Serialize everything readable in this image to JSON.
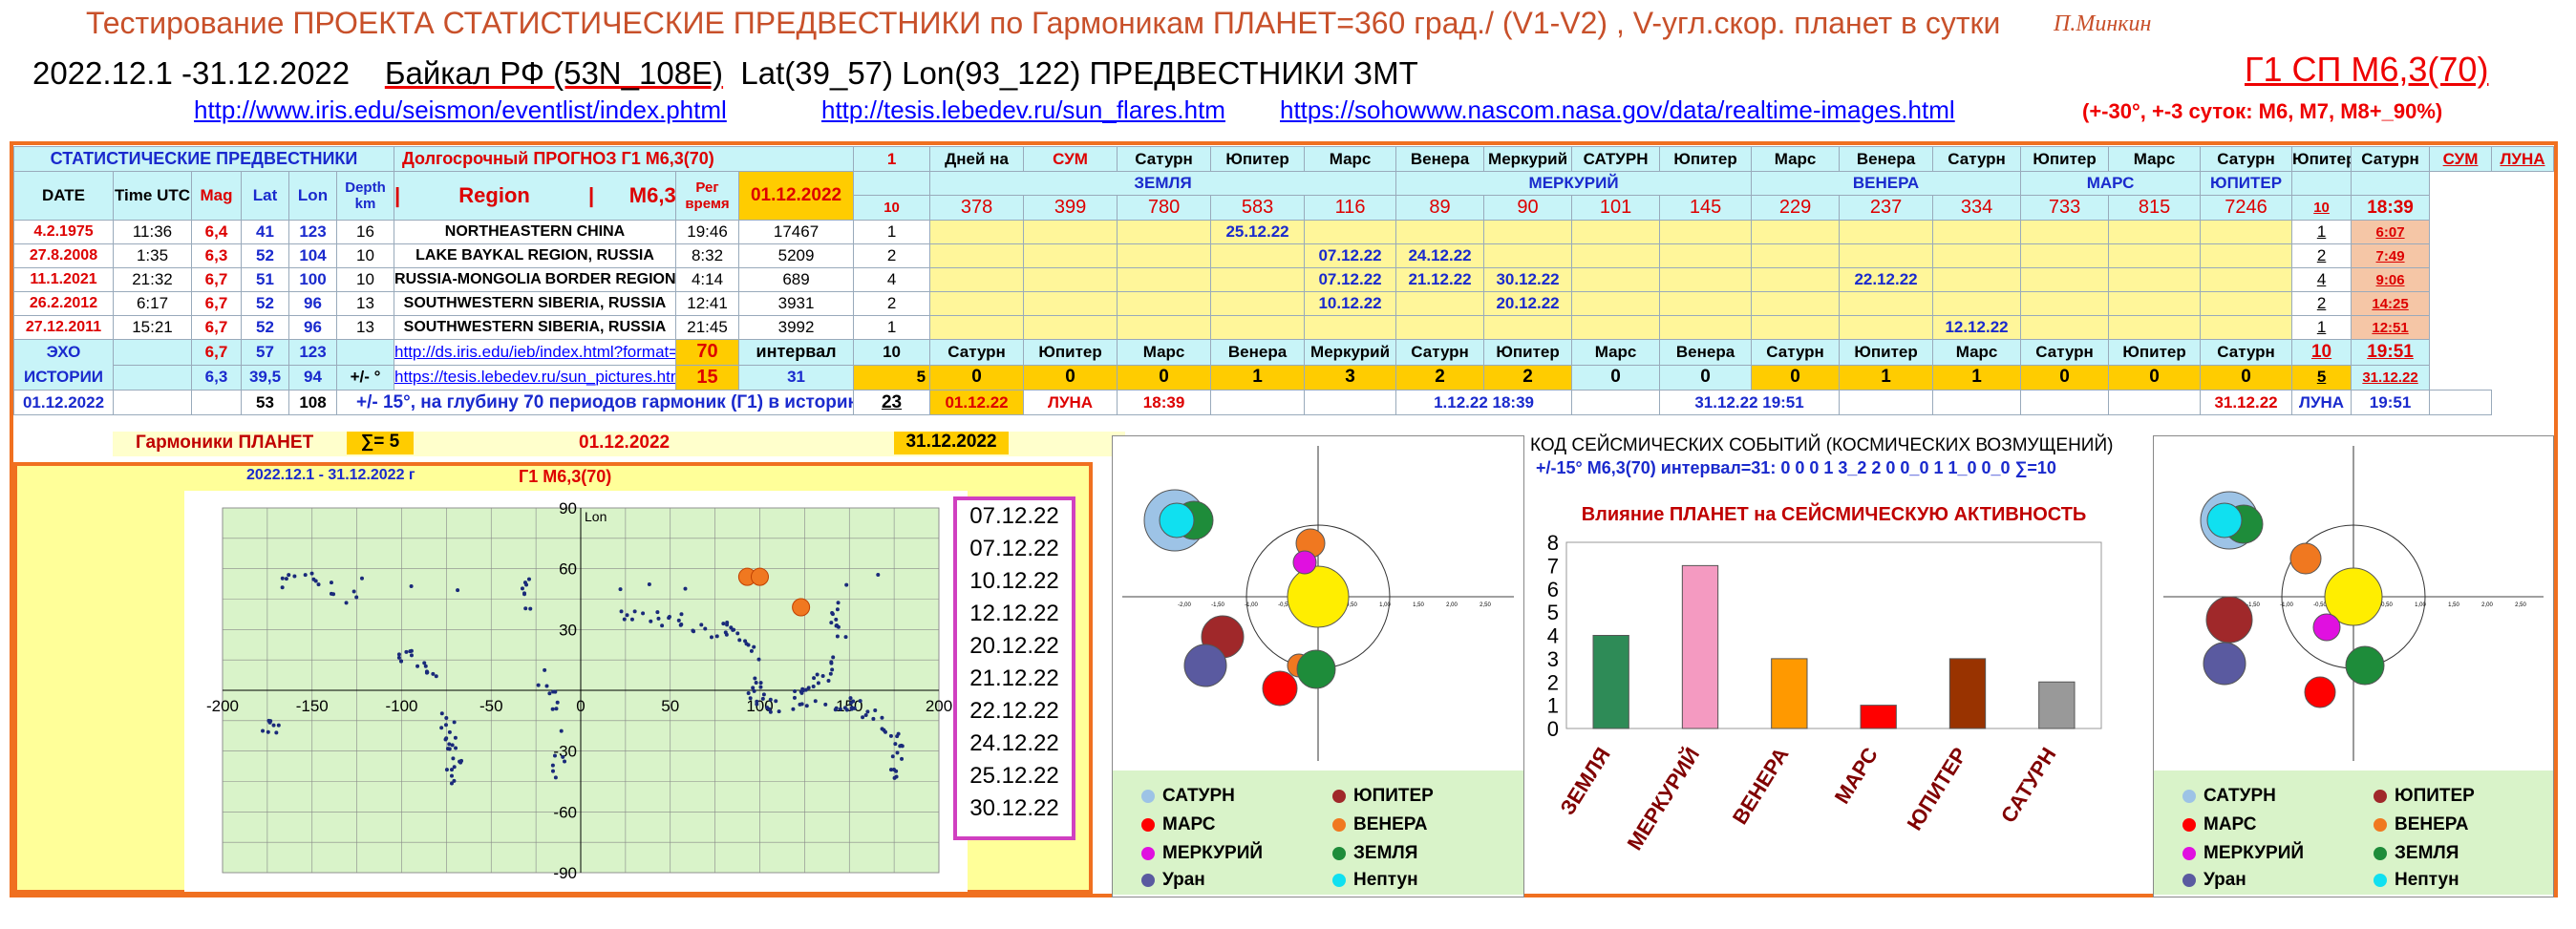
{
  "header": {
    "title": "Тестирование ПРОЕКТА СТАТИСТИЧЕСКИЕ ПРЕДВЕСТНИКИ по Гармоникам ПЛАНЕТ=360 град./ (V1-V2) , V-угл.скор. планет в сутки",
    "author": "П.Минкин",
    "period": "2022.12.1 -31.12.2022",
    "region_name": "Байкал РФ (53N_108E)",
    "coords": "Lat(39_57) Lon(93_122) ПРЕДВЕСТНИКИ ЗМТ",
    "g1": "Г1 СП М6,3(70)",
    "link1": "http://www.iris.edu/seismon/eventlist/index.phtml",
    "link2": "http://tesis.lebedev.ru/sun_flares.htm",
    "link3": "https://sohowww.nascom.nasa.gov/data/realtime-images.html",
    "note": "(+-30°, +-3 суток: М6, М7, М8+_90%)"
  },
  "table": {
    "r1": {
      "stat": "СТАТИСТИЧЕСКИЕ ПРЕДВЕСТНИКИ",
      "forecast": "Долгосрочный ПРОГНОЗ Г1 М6,3(70)",
      "one": "1",
      "days": "Дней на",
      "sum": "СУМ",
      "saturn": "Сатурн",
      "jupiter": "Юпитер",
      "mars": "Марс",
      "venus": "Венера",
      "mercury": "Меркурий",
      "saturn_caps": "САТУРН",
      "sum2": "СУМ",
      "moon": "ЛУНА"
    },
    "groups": {
      "earth": "ЗЕМЛЯ",
      "mercury": "МЕРКУРИЙ",
      "venus": "ВЕНЕРА",
      "mars": "МАРС",
      "jupiter": "ЮПИТЕР"
    },
    "r2": {
      "date": "DATE",
      "time": "Time UTC",
      "mag": "Mag",
      "lat": "Lat",
      "lon": "Lon",
      "depth": "Depth km",
      "region": "|          Region          |      M6,3+",
      "reg_time": "Рег время",
      "date_value": "01.12.2022",
      "ten": "10",
      "periods": [
        "378",
        "399",
        "780",
        "583",
        "116",
        "89",
        "90",
        "101",
        "145",
        "229",
        "237",
        "334",
        "733",
        "815",
        "7246"
      ],
      "ten2": "10",
      "moon_time": "18:39"
    },
    "events": [
      {
        "date": "4.2.1975",
        "time": "11:36",
        "mag": "6,4",
        "lat": "41",
        "lon": "123",
        "depth": "16",
        "region": "NORTHEASTERN CHINA",
        "rt": "19:46",
        "days": "17467",
        "sum": "1",
        "c": [
          "",
          "",
          "",
          "25.12.22",
          "",
          "",
          "",
          "",
          "",
          "",
          "",
          "",
          "",
          "",
          ""
        ],
        "s2": "1",
        "moon": "6:07"
      },
      {
        "date": "27.8.2008",
        "time": "1:35",
        "mag": "6,3",
        "lat": "52",
        "lon": "104",
        "depth": "10",
        "region": "LAKE BAYKAL REGION, RUSSIA",
        "rt": "8:32",
        "days": "5209",
        "sum": "2",
        "c": [
          "",
          "",
          "",
          "",
          "07.12.22",
          "24.12.22",
          "",
          "",
          "",
          "",
          "",
          "",
          "",
          "",
          ""
        ],
        "s2": "2",
        "moon": "7:49"
      },
      {
        "date": "11.1.2021",
        "time": "21:32",
        "mag": "6,7",
        "lat": "51",
        "lon": "100",
        "depth": "10",
        "region": "RUSSIA-MONGOLIA BORDER REGION",
        "rt": "4:14",
        "days": "689",
        "sum": "4",
        "c": [
          "",
          "",
          "",
          "",
          "07.12.22",
          "21.12.22",
          "30.12.22",
          "",
          "",
          "",
          "22.12.22",
          "",
          "",
          "",
          ""
        ],
        "s2": "4",
        "moon": "9:06"
      },
      {
        "date": "26.2.2012",
        "time": "6:17",
        "mag": "6,7",
        "lat": "52",
        "lon": "96",
        "depth": "13",
        "region": "SOUTHWESTERN SIBERIA, RUSSIA",
        "rt": "12:41",
        "days": "3931",
        "sum": "2",
        "c": [
          "",
          "",
          "",
          "",
          "10.12.22",
          "",
          "20.12.22",
          "",
          "",
          "",
          "",
          "",
          "",
          "",
          ""
        ],
        "s2": "2",
        "moon": "14:25"
      },
      {
        "date": "27.12.2011",
        "time": "15:21",
        "mag": "6,7",
        "lat": "52",
        "lon": "96",
        "depth": "13",
        "region": "SOUTHWESTERN SIBERIA, RUSSIA",
        "rt": "21:45",
        "days": "3992",
        "sum": "1",
        "c": [
          "",
          "",
          "",
          "",
          "",
          "",
          "",
          "",
          "",
          "",
          "",
          "12.12.22",
          "",
          "",
          ""
        ],
        "s2": "1",
        "moon": "12:51"
      }
    ],
    "echo": {
      "l1": "ЭХО",
      "l2": "ИСТОРИИ",
      "mag1": "6,7",
      "lat1": "57",
      "lon1": "123",
      "mag2": "6,3",
      "lat2": "39,5",
      "lon2": "94",
      "pm": "+/- °",
      "url1": "http://ds.iris.edu/ieb/index.html?format=te",
      "url2": "https://tesis.lebedev.ru/sun_pictures.html?m=12&d=",
      "n70": "70",
      "n15": "15",
      "interval": "интервал",
      "n31": "31",
      "ten": "10",
      "five": "5",
      "names": [
        "Сатурн",
        "Юпитер",
        "Марс",
        "Венера",
        "Меркурий",
        "Сатурн",
        "Юпитер",
        "Марс",
        "Венера",
        "Сатурн",
        "Юпитер",
        "Марс",
        "Сатурн",
        "Юпитер",
        "Сатурн"
      ],
      "counts": [
        "0",
        "0",
        "0",
        "1",
        "3",
        "2",
        "2",
        "0",
        "0",
        "0",
        "1",
        "1",
        "0",
        "0",
        "0"
      ],
      "five2": "5",
      "ten2": "10",
      "moon_t": "19:51",
      "moon_d": "31.12.22"
    },
    "r10": {
      "date": "01.12.2022",
      "n53": "53",
      "n108": "108",
      "desc": "+/- 15°, на глубину 70 периодов гармоник (Г1) в историю",
      "n23": "23",
      "d1": "01.12.22",
      "moon": "ЛУНА",
      "t1": "18:39",
      "p1": "1.12.22 18:39",
      "p2": "31.12.22 19:51",
      "d2": "31.12.22",
      "moon2": "ЛУНА",
      "t2": "19:51"
    }
  },
  "harmonics": {
    "label": "Гармоники ПЛАНЕТ",
    "sum": "∑= 5",
    "d1": "01.12.2022",
    "d2": "31.12.2022"
  },
  "map": {
    "title_left": "2022.12.1 - 31.12.2022 г",
    "title_right": "Г1 М6,3(70)",
    "lon_label": "Lon",
    "x_ticks": [
      "-200",
      "-150",
      "-100",
      "-50",
      "0",
      "50",
      "100",
      "150",
      "200"
    ],
    "y_ticks": [
      "90",
      "60",
      "30",
      "0",
      "-30",
      "-60",
      "-90"
    ],
    "dates": [
      "07.12.22",
      "07.12.22",
      "10.12.22",
      "12.12.22",
      "20.12.22",
      "21.12.22",
      "22.12.22",
      "24.12.22",
      "25.12.22",
      "30.12.22"
    ]
  },
  "code": {
    "title": "КОД СЕЙСМИЧЕСКИХ СОБЫТИЙ (КОСМИЧЕСКИХ ВОЗМУЩЕНИЙ)",
    "line": "+/-15° М6,3(70) интервал=31: 0 0 0 1 3_2 2 0 0_0 1 1_0 0_0 ∑=10"
  },
  "legend": {
    "saturn": "САТУРН",
    "jupiter": "ЮПИТЕР",
    "mars": "МАРС",
    "venus": "ВЕНЕРА",
    "mercury": "МЕРКУРИЙ",
    "earth": "ЗЕМЛЯ",
    "uranus": "Уран",
    "neptune": "Нептун"
  },
  "colors": {
    "saturn": "#9dc3e6",
    "jupiter": "#a0282a",
    "mars": "#ff0000",
    "venus": "#f07820",
    "mercury": "#e010e0",
    "earth": "#1e8c3a",
    "uranus": "#5a5aa0",
    "neptune": "#10e0f0",
    "sun": "#ffee00"
  },
  "chart_data": {
    "type": "bar",
    "title": "Влияние ПЛАНЕТ на СЕЙСМИЧЕСКУЮ АКТИВНОСТЬ",
    "categories": [
      "ЗЕМЛЯ",
      "МЕРКУРИЙ",
      "ВЕНЕРА",
      "МАРС",
      "ЮПИТЕР",
      "САТУРН"
    ],
    "values": [
      4,
      7,
      3,
      1,
      3,
      2
    ],
    "bar_colors": [
      "#2e8b57",
      "#f49ac1",
      "#ff9900",
      "#ff0000",
      "#993300",
      "#999999"
    ],
    "ylim": [
      0,
      8
    ],
    "y_ticks": [
      "0",
      "1",
      "2",
      "3",
      "4",
      "5",
      "6",
      "7",
      "8"
    ]
  },
  "orbit_ticks": [
    "-2,00",
    "-1,50",
    "-1,00",
    "-0,50",
    "0,00",
    "0,50",
    "1,00",
    "1,50",
    "2,00",
    "2,50"
  ]
}
